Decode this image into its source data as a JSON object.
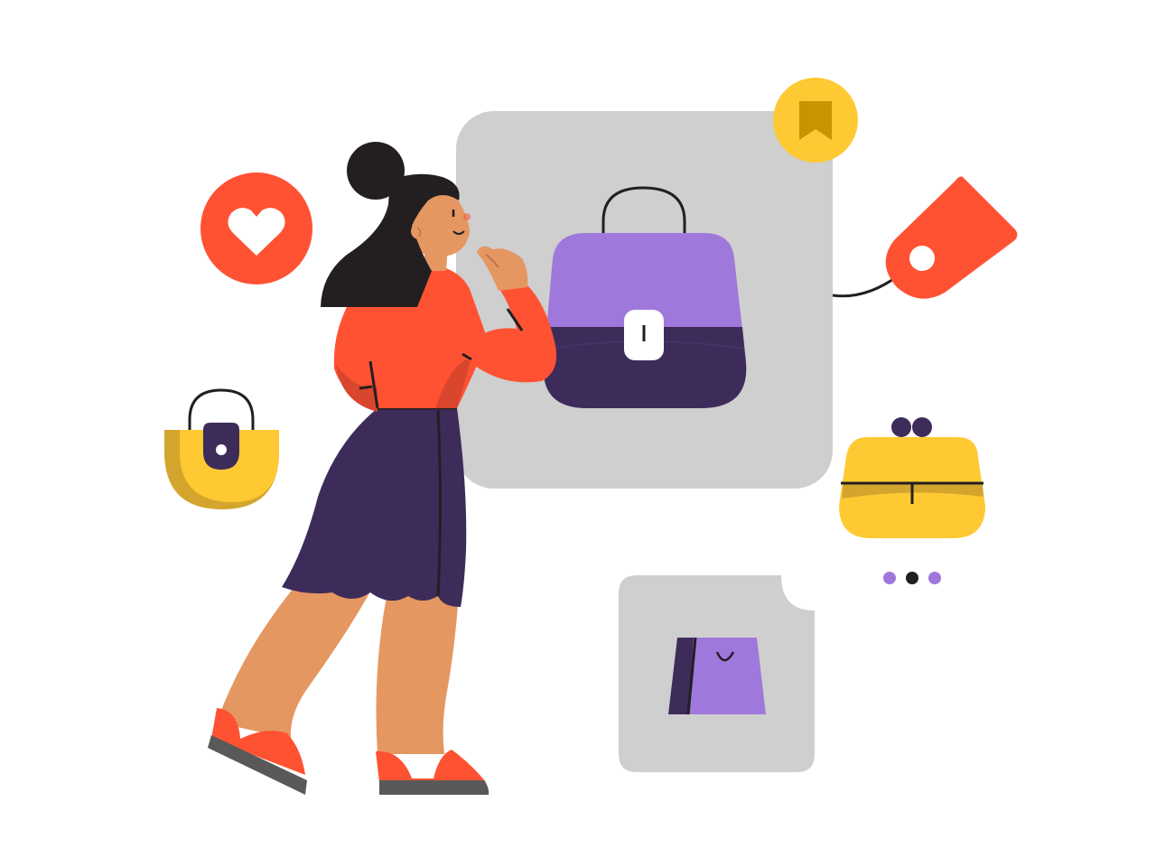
{
  "scene": {
    "subject": "woman-shopping-for-bags",
    "icons": [
      "heart-icon",
      "bookmark-icon",
      "price-tag-icon",
      "padlock-bag-icon",
      "coin-purse-icon",
      "shopping-bag-icon",
      "more-dots-icon"
    ]
  },
  "colors": {
    "background": "#ffffff",
    "card_gray": "#cfcfcf",
    "accent_red": "#ff5233",
    "accent_yellow": "#ffc933",
    "dark_yellow": "#d4a52c",
    "accent_purple": "#9f78dc",
    "dark_purple": "#3d2c5a",
    "skin": "#e59762",
    "hair": "#231f20",
    "shoe_sole": "#595959"
  },
  "carousel": {
    "dots": 3,
    "active_index": 1
  }
}
